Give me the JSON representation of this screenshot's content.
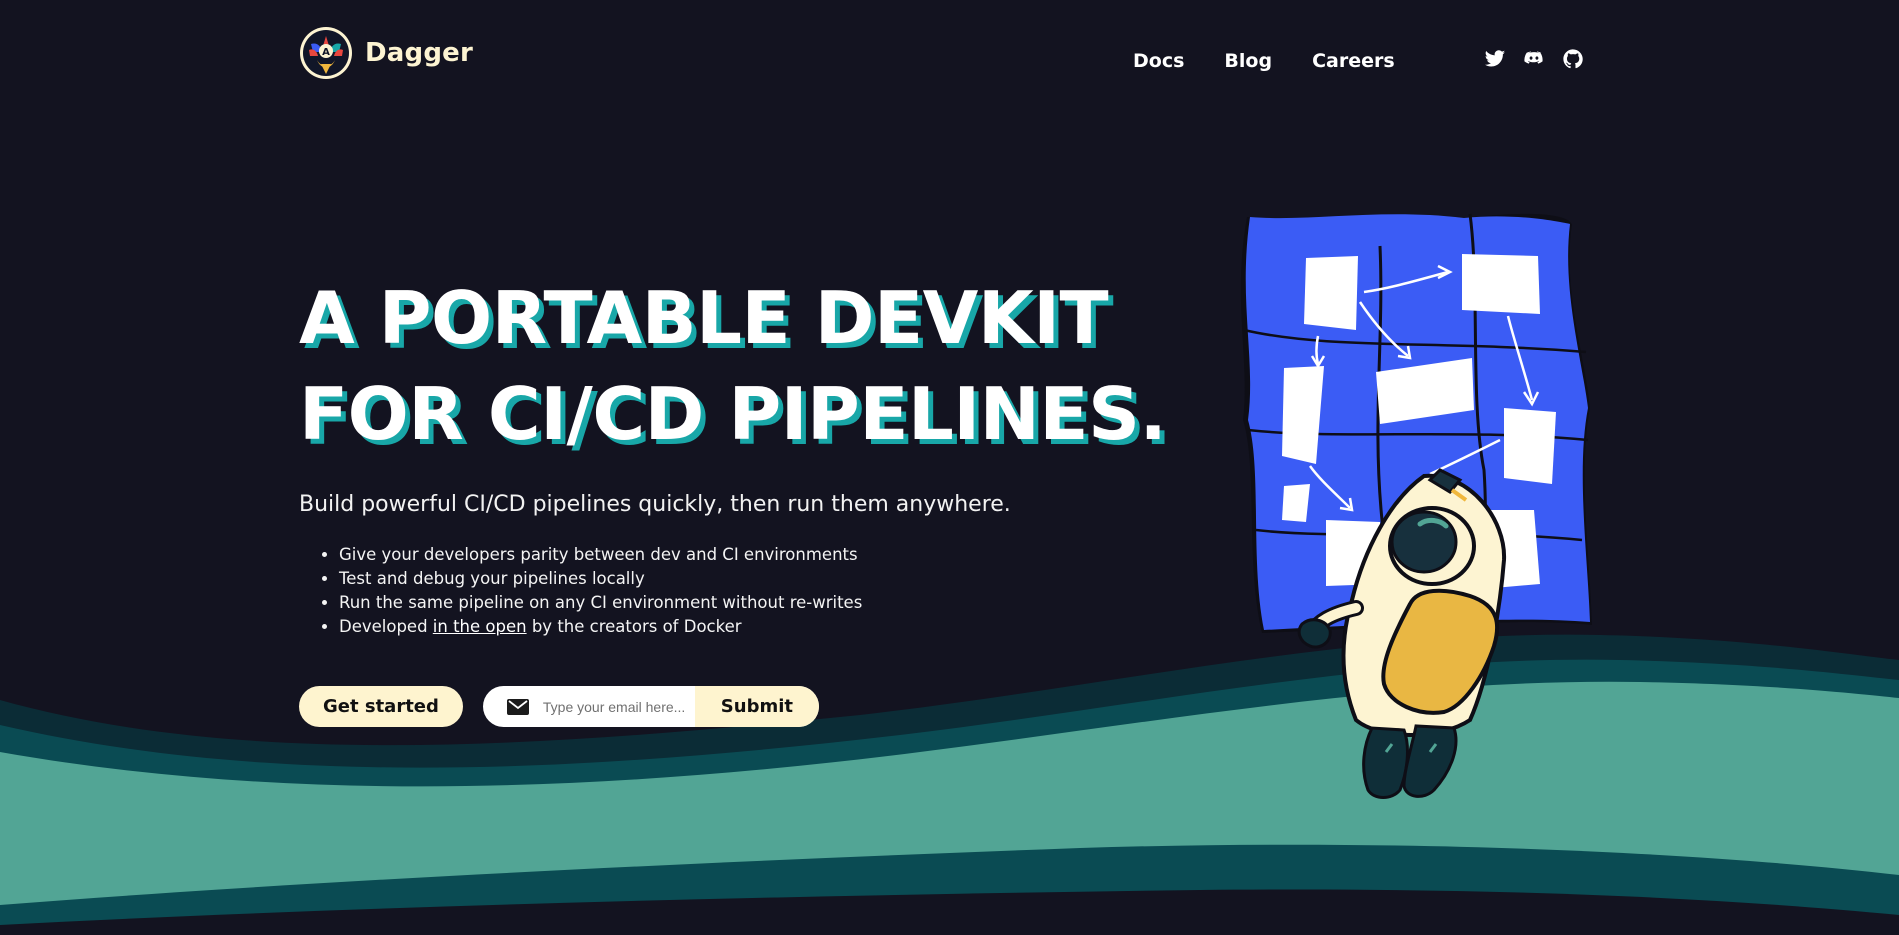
{
  "brand": {
    "name": "Dagger",
    "logo_icon": "dagger-logo-icon"
  },
  "nav": {
    "items": [
      "Docs",
      "Blog",
      "Careers"
    ]
  },
  "socials": [
    "twitter-icon",
    "discord-icon",
    "github-icon"
  ],
  "hero": {
    "headline_line1": "A PORTABLE DEVKIT",
    "headline_line2": "FOR CI/CD PIPELINES.",
    "lead": "Build powerful CI/CD pipelines quickly, then run them anywhere.",
    "bullets": {
      "b1": "Give your developers parity between dev and CI environments",
      "b2": "Test and debug your pipelines locally",
      "b3": "Run the same pipeline on any CI environment without re-writes",
      "b4_pre": "Developed ",
      "b4_link": "in the open",
      "b4_post": " by the creators of Docker"
    }
  },
  "cta": {
    "get_started": "Get started",
    "email_placeholder": "Type your email here...",
    "submit": "Submit",
    "mail_icon": "mail-icon"
  },
  "colors": {
    "background": "#131320",
    "accent_teal": "#18a7a8",
    "cream": "#fef4cf",
    "wave_light": "#52a595",
    "wave_dark": "#0a4b53",
    "map_blue": "#3b5cf5"
  }
}
